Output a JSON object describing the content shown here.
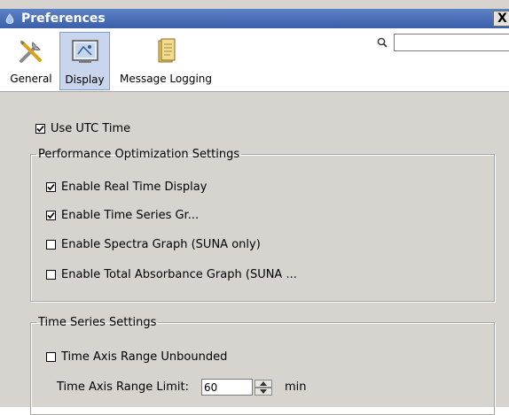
{
  "window": {
    "title": "Preferences",
    "close_label": "X"
  },
  "toolbar": {
    "tabs": [
      {
        "label": "General",
        "icon": "tools-icon",
        "selected": false
      },
      {
        "label": "Display",
        "icon": "display-settings-icon",
        "selected": true
      },
      {
        "label": "Message Logging",
        "icon": "log-file-icon",
        "selected": false
      }
    ],
    "search": {
      "value": "",
      "placeholder": ""
    }
  },
  "display": {
    "use_utc": {
      "label": "Use UTC Time",
      "checked": true
    },
    "performance": {
      "title": "Performance Optimization Settings",
      "items": [
        {
          "label": "Enable Real Time Display",
          "checked": true
        },
        {
          "label": "Enable Time Series Gr...",
          "checked": true
        },
        {
          "label": "Enable Spectra Graph (SUNA only)",
          "checked": false
        },
        {
          "label": "Enable Total Absorbance Graph (SUNA ...",
          "checked": false
        }
      ]
    },
    "time_series": {
      "title": "Time Series Settings",
      "unbounded": {
        "label": "Time Axis Range Unbounded",
        "checked": false
      },
      "limit": {
        "label": "Time Axis Range Limit:",
        "value": "60",
        "unit": "min"
      }
    }
  },
  "colors": {
    "titlebar": "#3b5fa9",
    "selected_tab": "#c9d5ec",
    "panel": "#d7d4cf"
  }
}
